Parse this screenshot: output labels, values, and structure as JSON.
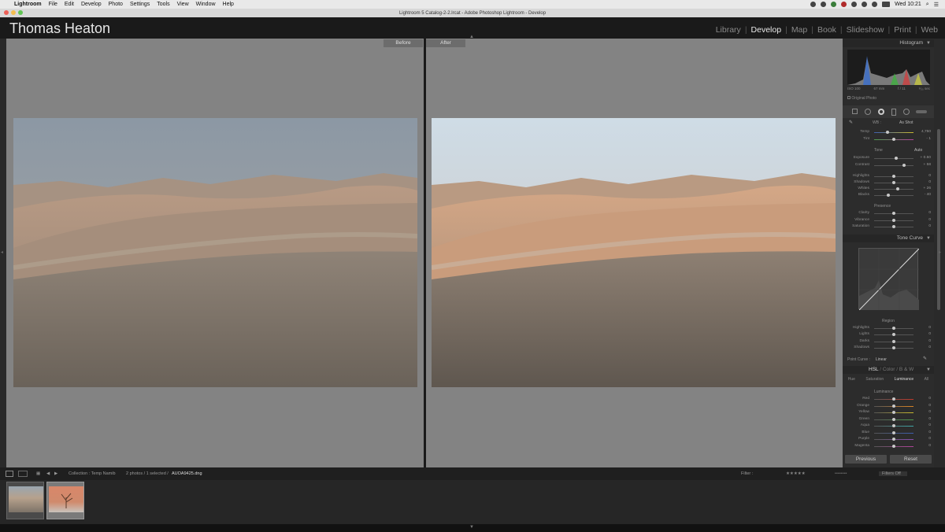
{
  "menubar": {
    "apple": "",
    "items": [
      "Lightroom",
      "File",
      "Edit",
      "Develop",
      "Photo",
      "Settings",
      "Tools",
      "View",
      "Window",
      "Help"
    ],
    "clock": "Wed 10:21"
  },
  "window": {
    "title": "Lightroom 5 Catalog-2-2.lrcat - Adobe Photoshop Lightroom - Develop"
  },
  "identity_plate": "Thomas Heaton",
  "modules": [
    "Library",
    "Develop",
    "Map",
    "Book",
    "Slideshow",
    "Print",
    "Web"
  ],
  "active_module": "Develop",
  "compare": {
    "before_label": "Before",
    "after_label": "After"
  },
  "panels": {
    "histogram": {
      "title": "Histogram",
      "info": [
        "ISO 100",
        "67 mm",
        "f / 11",
        "¹⁄₅₀ sec"
      ],
      "original_photo": "Original Photo"
    },
    "basic": {
      "wb_label": "WB :",
      "wb_value": "As Shot",
      "temp_label": "Temp",
      "temp_value": "4,750",
      "tint_label": "Tint",
      "tint_value": "- 1",
      "tone_label": "Tone",
      "auto_label": "Auto",
      "sliders": [
        {
          "label": "Exposure",
          "value": "+ 0.50",
          "pos": 0.55
        },
        {
          "label": "Contrast",
          "value": "+ 58",
          "pos": 0.75
        },
        {
          "label": "Highlights",
          "value": "0",
          "pos": 0.5
        },
        {
          "label": "Shadows",
          "value": "0",
          "pos": 0.5
        },
        {
          "label": "Whites",
          "value": "+ 26",
          "pos": 0.6
        },
        {
          "label": "Blacks",
          "value": "- 40",
          "pos": 0.35
        }
      ],
      "presence_label": "Presence",
      "presence_sliders": [
        {
          "label": "Clarity",
          "value": "0",
          "pos": 0.5
        },
        {
          "label": "Vibrance",
          "value": "0",
          "pos": 0.5
        },
        {
          "label": "Saturation",
          "value": "0",
          "pos": 0.5
        }
      ]
    },
    "tone_curve": {
      "title": "Tone Curve",
      "region_label": "Region",
      "sliders": [
        {
          "label": "Highlights",
          "value": "0",
          "pos": 0.5
        },
        {
          "label": "Lights",
          "value": "0",
          "pos": 0.5
        },
        {
          "label": "Darks",
          "value": "0",
          "pos": 0.5
        },
        {
          "label": "Shadows",
          "value": "0",
          "pos": 0.5
        }
      ],
      "point_curve_label": "Point Curve :",
      "point_curve_value": "Linear"
    },
    "hsl": {
      "title_hsl": "HSL",
      "title_color": "Color",
      "title_bw": "B & W",
      "tabs": [
        "Hue",
        "Saturation",
        "Luminance",
        "All"
      ],
      "active_tab": "Luminance",
      "section_label": "Luminance",
      "sliders": [
        {
          "label": "Red",
          "value": "0",
          "color": "#c0392b"
        },
        {
          "label": "Orange",
          "value": "0",
          "color": "#d98324"
        },
        {
          "label": "Yellow",
          "value": "0",
          "color": "#c9b92e"
        },
        {
          "label": "Green",
          "value": "0",
          "color": "#4e9a4e"
        },
        {
          "label": "Aqua",
          "value": "0",
          "color": "#3fa7a7"
        },
        {
          "label": "Blue",
          "value": "0",
          "color": "#3d5fb0"
        },
        {
          "label": "Purple",
          "value": "0",
          "color": "#8a4fb0"
        },
        {
          "label": "Magenta",
          "value": "0",
          "color": "#b0439a"
        }
      ]
    },
    "buttons": {
      "previous": "Previous",
      "reset": "Reset"
    }
  },
  "toolbar": {
    "collection": "Collection : Temp Namib",
    "count": "2 photos / 1 selected /",
    "filename": "AUOA9425.dng",
    "filter_label": "Filter :",
    "filters_off": "Filters Off"
  }
}
